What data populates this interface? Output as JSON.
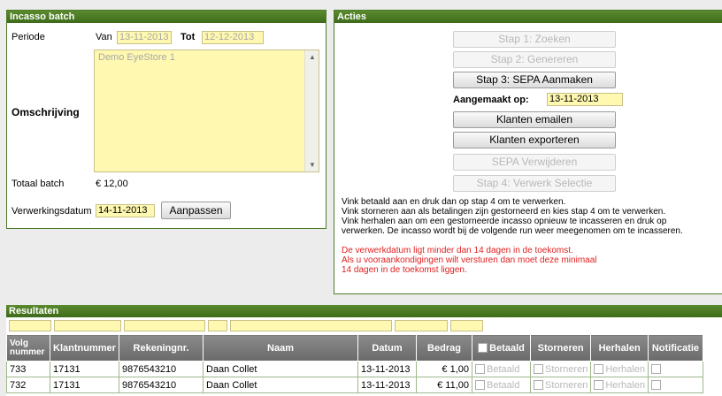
{
  "incasso": {
    "title": "Incasso batch",
    "periode_label": "Periode",
    "van_label": "Van",
    "van_value": "13-11-2013",
    "tot_label": "Tot",
    "tot_value": "12-12-2013",
    "omschrijving_label": "Omschrijving",
    "omschrijving_value": "Demo EyeStore 1",
    "totaal_label": "Totaal batch",
    "totaal_value": "€ 12,00",
    "verwerkingsdatum_label": "Verwerkingsdatum",
    "verwerkingsdatum_value": "14-11-2013",
    "aanpassen_label": "Aanpassen"
  },
  "acties": {
    "title": "Acties",
    "stap1": "Stap 1: Zoeken",
    "stap2": "Stap 2: Genereren",
    "stap3": "Stap 3: SEPA Aanmaken",
    "aangemaakt_label": "Aangemaakt op:",
    "aangemaakt_value": "13-11-2013",
    "klanten_emailen": "Klanten emailen",
    "klanten_exporteren": "Klanten exporteren",
    "sepa_verwijderen": "SEPA Verwijderen",
    "stap4": "Stap 4: Verwerk Selectie",
    "info1": "Vink betaald aan en druk dan op stap 4 om te verwerken.",
    "info2": "Vink storneren aan als betalingen zijn gestorneerd en kies stap 4 om te verwerken.",
    "info3": "Vink herhalen aan om een gestorneerde incasso opnieuw te incasseren en druk op",
    "info4": "verwerken. De incasso wordt bij de volgende run weer meegenomen om te incasseren.",
    "warn1": "De verwerkdatum ligt minder dan 14 dagen in de toekomst.",
    "warn2": "Als u vooraankondigingen wilt versturen dan moet deze minimaal",
    "warn3": "14 dagen in de toekomst liggen."
  },
  "resultaten": {
    "title": "Resultaten",
    "columns": {
      "volg": "Volg nummer",
      "klantnummer": "Klantnummer",
      "rekeningnr": "Rekeningnr.",
      "naam": "Naam",
      "datum": "Datum",
      "bedrag": "Bedrag",
      "betaald": "Betaald",
      "storneren": "Storneren",
      "herhalen": "Herhalen",
      "notificatie": "Notificatie"
    },
    "rows": [
      {
        "volg": "733",
        "klantnummer": "17131",
        "rekeningnr": "9876543210",
        "naam": "Daan Collet",
        "datum": "13-11-2013",
        "bedrag": "€ 1,00",
        "betaald": "Betaald",
        "storneren": "Storneren",
        "herhalen": "Herhalen"
      },
      {
        "volg": "732",
        "klantnummer": "17131",
        "rekeningnr": "9876543210",
        "naam": "Daan Collet",
        "datum": "13-11-2013",
        "bedrag": "€ 11,00",
        "betaald": "Betaald",
        "storneren": "Storneren",
        "herhalen": "Herhalen"
      }
    ]
  },
  "colors": {
    "header_green": "#4e7a2a",
    "input_yellow": "#fff8b0",
    "table_header_gray": "#7a7a7a",
    "warning_red": "#e02020"
  }
}
